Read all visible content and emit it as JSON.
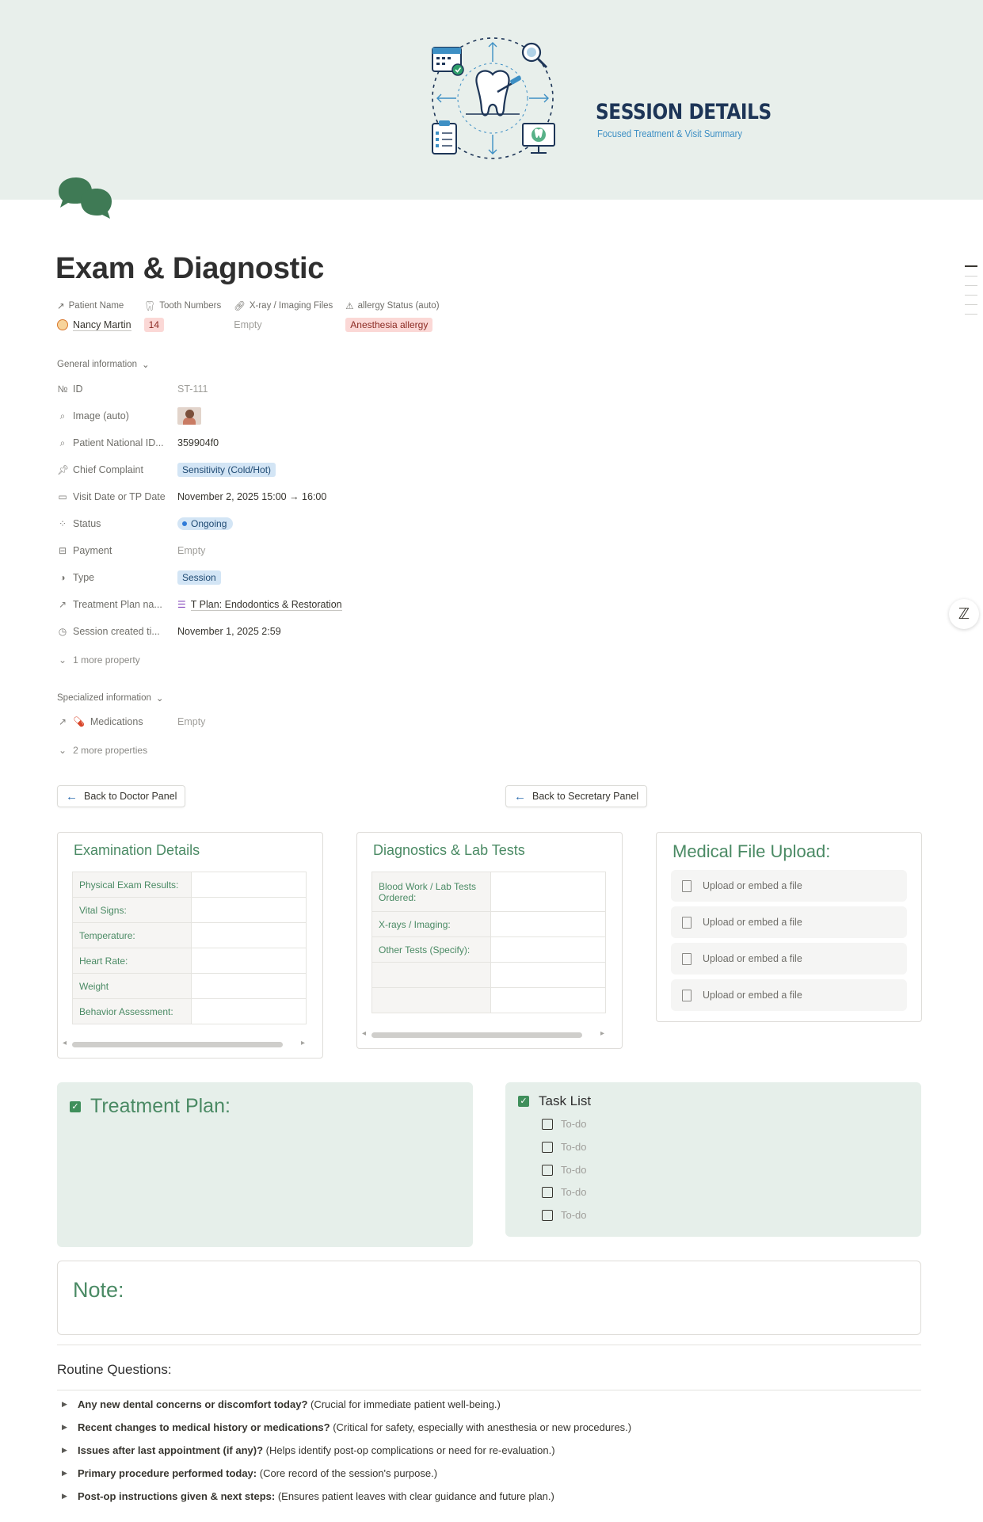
{
  "cover": {
    "title": "SESSION DETAILS",
    "subtitle": "Focused Treatment & Visit Summary",
    "art_icon": "dental-tooth-illustration"
  },
  "page": {
    "title": "Exam & Diagnostic",
    "icon": "chat-bubbles-icon"
  },
  "pinned": {
    "patient_name": {
      "label": "Patient Name",
      "value": "Nancy Martin"
    },
    "tooth_numbers": {
      "label": "Tooth Numbers",
      "value": "14"
    },
    "xray": {
      "label": "X-ray / Imaging Files",
      "value": "Empty"
    },
    "allergy": {
      "label": "allergy Status (auto)",
      "value": "Anesthesia allergy"
    }
  },
  "general": {
    "header": "General information",
    "rows": {
      "id": {
        "label": "ID",
        "value": "ST-111"
      },
      "image": {
        "label": "Image (auto)"
      },
      "national_id": {
        "label": "Patient National ID...",
        "value": "359904f0"
      },
      "chief_complaint": {
        "label": "Chief Complaint",
        "value": "Sensitivity (Cold/Hot)"
      },
      "visit_date": {
        "label": "Visit Date or TP Date",
        "value": "November 2, 2025 15:00 → 16:00"
      },
      "status": {
        "label": "Status",
        "value": "Ongoing"
      },
      "payment": {
        "label": "Payment",
        "value": "Empty"
      },
      "type": {
        "label": "Type",
        "value": "Session"
      },
      "treatment_plan": {
        "label": "Treatment Plan na...",
        "value": "T Plan: Endodontics & Restoration"
      },
      "session_created": {
        "label": "Session created ti...",
        "value": "November 1, 2025 2:59"
      }
    },
    "more": "1 more property"
  },
  "specialized": {
    "header": "Specialized information",
    "medications": {
      "label": "Medications",
      "value": "Empty"
    },
    "more": "2 more properties"
  },
  "buttons": {
    "doctor": "Back to Doctor Panel",
    "secretary": "Back to Secretary Panel"
  },
  "exam": {
    "title": "Examination Details",
    "rows": [
      "Physical Exam Results:",
      "Vital Signs:",
      "Temperature:",
      "Heart Rate:",
      "Weight",
      "Behavior Assessment:"
    ]
  },
  "diag": {
    "title": "Diagnostics & Lab Tests",
    "rows": [
      "Blood Work / Lab Tests Ordered:",
      "X-rays / Imaging:",
      "Other Tests (Specify):",
      "",
      ""
    ]
  },
  "upload": {
    "title": "Medical File Upload:",
    "items": [
      "Upload or embed a file",
      "Upload or embed a file",
      "Upload or embed a file",
      "Upload or embed a file"
    ]
  },
  "treatment": {
    "title": "Treatment Plan:"
  },
  "tasks": {
    "title": "Task List",
    "items": [
      "To-do",
      "To-do",
      "To-do",
      "To-do",
      "To-do"
    ]
  },
  "note": {
    "title": "Note:"
  },
  "questions": {
    "title": "Routine Questions:",
    "items": [
      {
        "q": "Any new dental concerns or discomfort today?",
        "d": " (Crucial for immediate patient well-being.)"
      },
      {
        "q": "Recent changes to medical history or medications?",
        "d": " (Critical for safety, especially with anesthesia or new procedures.)"
      },
      {
        "q": "Issues after last appointment (if any)?",
        "d": " (Helps identify post-op complications or need for re-evaluation.)"
      },
      {
        "q": "Primary procedure performed today:",
        "d": " (Core record of the session's purpose.)"
      },
      {
        "q": "Post-op instructions given & next steps:",
        "d": " (Ensures patient leaves with clear guidance and future plan.)"
      }
    ]
  },
  "colors": {
    "accent_green": "#4a8a64",
    "block_green": "#e6efea",
    "cover_bg": "#e8efeb",
    "cover_title": "#1d3557"
  }
}
